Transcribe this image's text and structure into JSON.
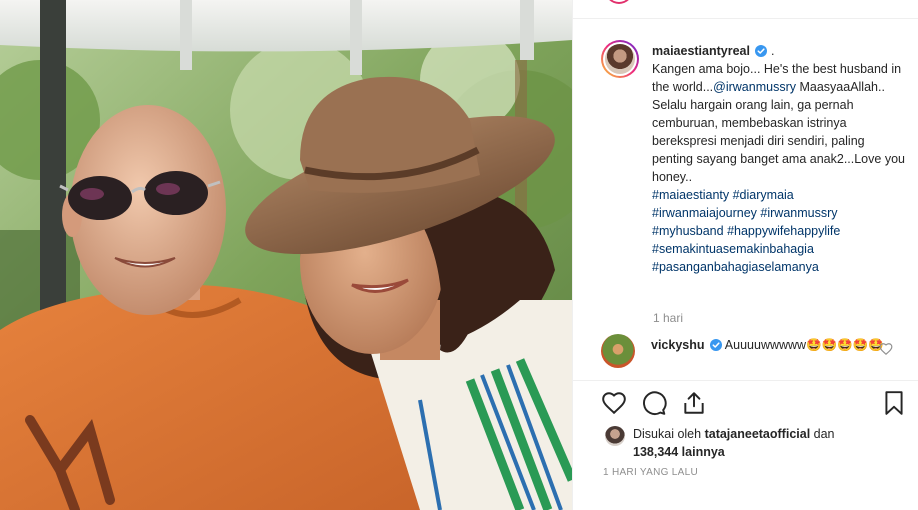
{
  "post": {
    "photo_alt": "",
    "username": "maiaestiantyreal",
    "username_suffix": ".",
    "caption_line1": "Kangen ama bojo... He's the best husband in the world...",
    "mention": "@irwanmussry",
    "caption_line2": "MaasyaaAllah.. Selalu hargain orang lain, ga pernah cemburuan, membebaskan istrinya berekspresi menjadi diri sendiri, paling penting sayang banget ama anak2...Love you honey..",
    "hashtags": [
      "#maiaestianty",
      "#diarymaia",
      "#irwanmaiajourney",
      "#irwanmussry",
      "#myhusband",
      "#happywifehappylife",
      "#semakintuasemakinbahagia",
      "#pasanganbahagiaselamanya"
    ],
    "time_ago": "1 hari"
  },
  "comment": {
    "username": "vickyshu",
    "text": "Auuuuwwwww🤩🤩🤩🤩🤩"
  },
  "likes": {
    "prefix": "Disukai oleh",
    "user": "tatajaneetaofficial",
    "middle": "dan",
    "count": "138,344",
    "suffix": "lainnya"
  },
  "date": "1 HARI YANG LALU",
  "icons": {
    "verified_color": "#3897f0",
    "link_color": "#003569"
  }
}
